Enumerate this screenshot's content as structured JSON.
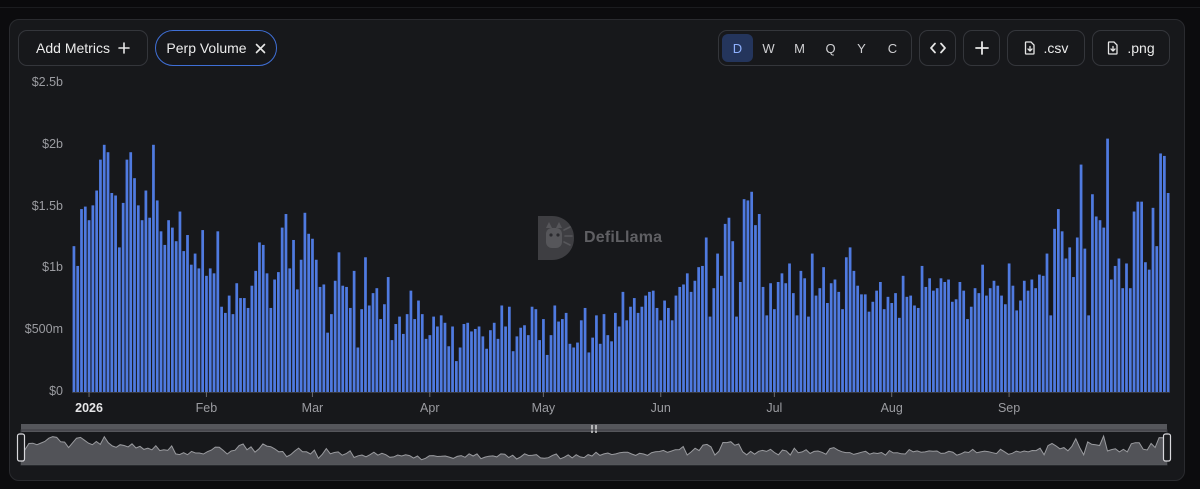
{
  "toolbar": {
    "add_metrics_label": "Add Metrics",
    "metric_chip_label": "Perp Volume",
    "periods": [
      "D",
      "W",
      "M",
      "Q",
      "Y",
      "C"
    ],
    "active_period": "D",
    "csv_label": ".csv",
    "png_label": ".png"
  },
  "watermark": "DefiLlama",
  "colors": {
    "bar": "#4f7ae0",
    "background": "#17181b",
    "accent": "#3f6fd6",
    "brush": "#8a8a8e"
  },
  "chart_data": {
    "type": "bar",
    "title": "",
    "xlabel": "",
    "ylabel": "",
    "ylim": [
      0,
      2500000000
    ],
    "y_ticks": [
      {
        "value": 0,
        "label": "$0"
      },
      {
        "value": 500000000,
        "label": "$500m"
      },
      {
        "value": 1000000000,
        "label": "$1b"
      },
      {
        "value": 1500000000,
        "label": "$1.5b"
      },
      {
        "value": 2000000000,
        "label": "$2b"
      },
      {
        "value": 2500000000,
        "label": "$2.5b"
      }
    ],
    "x_ticks": [
      {
        "label": "2026",
        "index": 4,
        "bold": true
      },
      {
        "label": "Feb",
        "index": 35,
        "bold": false
      },
      {
        "label": "Mar",
        "index": 63,
        "bold": false
      },
      {
        "label": "Apr",
        "index": 94,
        "bold": false
      },
      {
        "label": "May",
        "index": 124,
        "bold": false
      },
      {
        "label": "Jun",
        "index": 155,
        "bold": false
      },
      {
        "label": "Jul",
        "index": 185,
        "bold": false
      },
      {
        "label": "Aug",
        "index": 216,
        "bold": false
      },
      {
        "label": "Sep",
        "index": 247,
        "bold": false
      }
    ],
    "start_date": "2025-12-28",
    "values_billions": [
      1.18,
      1.02,
      1.48,
      1.5,
      1.39,
      1.51,
      1.63,
      1.88,
      2.0,
      1.94,
      1.61,
      1.59,
      1.17,
      1.53,
      1.88,
      1.94,
      1.73,
      1.51,
      1.39,
      1.63,
      1.41,
      2.0,
      1.55,
      1.3,
      1.19,
      1.39,
      1.33,
      1.22,
      1.46,
      1.14,
      1.27,
      1.03,
      1.12,
      1.0,
      1.31,
      0.94,
      1.0,
      0.96,
      1.3,
      0.69,
      0.64,
      0.78,
      0.63,
      0.88,
      0.76,
      0.76,
      0.68,
      0.86,
      0.98,
      1.21,
      1.19,
      0.96,
      0.68,
      0.91,
      0.97,
      1.33,
      1.44,
      1.0,
      1.23,
      0.83,
      1.07,
      1.45,
      1.28,
      1.24,
      1.07,
      0.85,
      0.87,
      0.48,
      0.63,
      0.9,
      1.13,
      0.86,
      0.85,
      0.68,
      0.98,
      0.36,
      0.67,
      1.09,
      0.7,
      0.8,
      0.84,
      0.59,
      0.71,
      0.93,
      0.42,
      0.55,
      0.61,
      0.47,
      0.63,
      0.82,
      0.59,
      0.74,
      0.63,
      0.43,
      0.46,
      0.61,
      0.53,
      0.62,
      0.56,
      0.37,
      0.53,
      0.25,
      0.36,
      0.55,
      0.56,
      0.49,
      0.51,
      0.53,
      0.45,
      0.35,
      0.5,
      0.56,
      0.43,
      0.7,
      0.53,
      0.69,
      0.33,
      0.45,
      0.52,
      0.54,
      0.46,
      0.69,
      0.67,
      0.42,
      0.59,
      0.3,
      0.46,
      0.7,
      0.57,
      0.59,
      0.64,
      0.39,
      0.36,
      0.4,
      0.58,
      0.68,
      0.32,
      0.44,
      0.62,
      0.39,
      0.63,
      0.46,
      0.41,
      0.64,
      0.53,
      0.81,
      0.58,
      0.69,
      0.76,
      0.64,
      0.69,
      0.78,
      0.81,
      0.82,
      0.68,
      0.58,
      0.74,
      0.68,
      0.58,
      0.78,
      0.85,
      0.87,
      0.96,
      0.81,
      0.9,
      1.01,
      1.02,
      1.25,
      0.61,
      0.84,
      1.12,
      0.94,
      1.36,
      1.41,
      1.22,
      0.61,
      0.89,
      1.56,
      1.55,
      1.62,
      1.35,
      1.44,
      0.85,
      0.62,
      0.88,
      0.67,
      0.89,
      0.96,
      0.88,
      1.04,
      0.8,
      0.62,
      0.98,
      0.92,
      0.61,
      1.12,
      0.78,
      0.84,
      1.01,
      0.72,
      0.88,
      0.91,
      0.81,
      0.67,
      1.09,
      1.17,
      0.98,
      0.86,
      0.79,
      0.79,
      0.65,
      0.73,
      0.82,
      0.89,
      0.67,
      0.77,
      0.72,
      0.8,
      0.6,
      0.94,
      0.77,
      0.78,
      0.7,
      0.68,
      1.02,
      0.85,
      0.92,
      0.82,
      0.84,
      0.92,
      0.89,
      0.91,
      0.73,
      0.75,
      0.89,
      0.82,
      0.59,
      0.69,
      0.84,
      0.8,
      1.03,
      0.78,
      0.84,
      0.9,
      0.86,
      0.78,
      0.71,
      1.04,
      0.86,
      0.66,
      0.74,
      0.9,
      0.82,
      0.91,
      0.84,
      0.95,
      0.94,
      1.12,
      0.62,
      1.32,
      1.48,
      1.3,
      1.08,
      1.17,
      0.93,
      1.25,
      1.84,
      1.16,
      0.62,
      1.6,
      1.42,
      1.39,
      1.33,
      2.05,
      0.91,
      1.02,
      1.08,
      0.84,
      1.04,
      0.84,
      1.46,
      1.54,
      1.54,
      1.05,
      0.99,
      1.49,
      1.18,
      1.93,
      1.91,
      1.61
    ]
  }
}
